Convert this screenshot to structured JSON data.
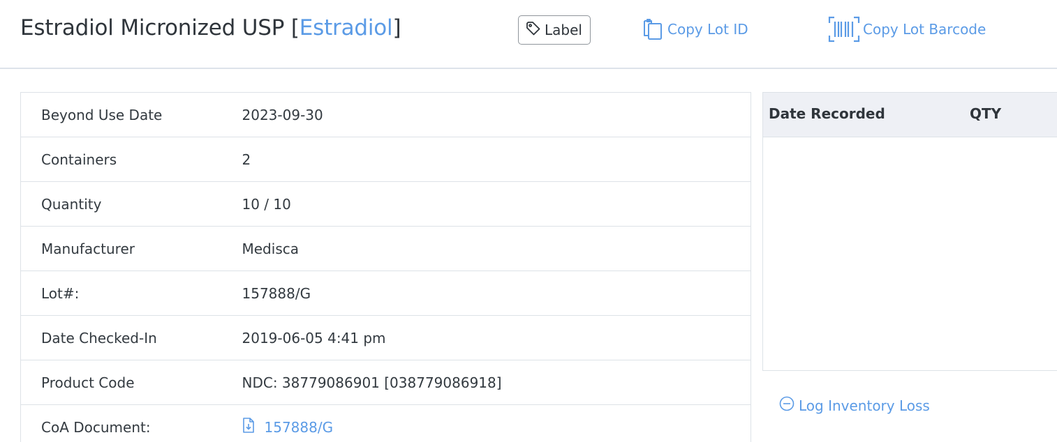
{
  "header": {
    "title": "Estradiol Micronized USP",
    "bracket_open": "[",
    "title_link": "Estradiol",
    "bracket_close": "]",
    "label_button": "Label",
    "copy_lot_id": "Copy Lot ID",
    "copy_lot_barcode": "Copy Lot Barcode",
    "accent_color": "#5b9be6"
  },
  "details": [
    {
      "key": "Beyond Use Date",
      "value": "2023-09-30"
    },
    {
      "key": "Containers",
      "value": "2"
    },
    {
      "key": "Quantity",
      "value": "10 / 10"
    },
    {
      "key": "Manufacturer",
      "value": "Medisca"
    },
    {
      "key": "Lot#:",
      "value": "157888/G"
    },
    {
      "key": "Date Checked-In",
      "value": "2019-06-05 4:41 pm"
    },
    {
      "key": "Product Code",
      "value": "NDC: 38779086901 [038779086918]"
    },
    {
      "key": "CoA Document:",
      "value": "157888/G",
      "icon": "document-download-icon"
    }
  ],
  "log_table": {
    "columns": [
      "Date Recorded",
      "QTY"
    ],
    "rows": []
  },
  "actions": {
    "log_inventory_loss": "Log Inventory Loss"
  }
}
